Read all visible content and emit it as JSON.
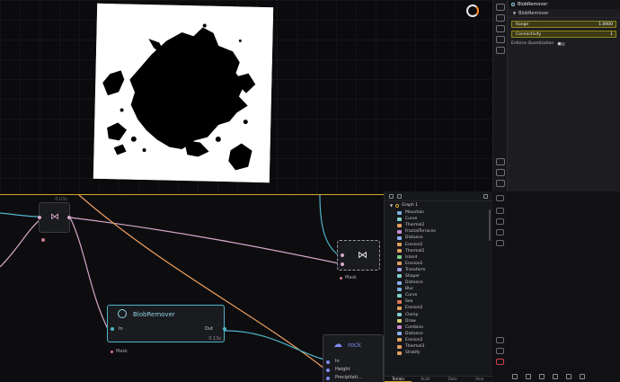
{
  "viewport": {
    "background": "#0b0b0d"
  },
  "properties": {
    "panel_title": "BlobRemover",
    "section_title": "BlobRemover",
    "fields": [
      {
        "label": "Range",
        "value": "1.0000"
      },
      {
        "label": "Connectivity",
        "value": "1"
      }
    ],
    "toggle_label": "Enforce Quantization"
  },
  "graph": {
    "small_node_time": "0.03s",
    "blob_node": {
      "title": "BlobRemover",
      "in_label": "In",
      "out_label": "Out",
      "time": "0.13s",
      "mask_label": "Mask"
    },
    "mid_node": {
      "mask_label": "Mask"
    },
    "rock_node": {
      "title": "rock",
      "pins": [
        "In",
        "Height",
        "Precipitati..."
      ]
    }
  },
  "library": {
    "root": "Graph 1",
    "items": [
      {
        "label": "Mountain",
        "color": "#7fb0e0"
      },
      {
        "label": "Curve",
        "color": "#7fd0c8"
      },
      {
        "label": "Thermal2",
        "color": "#e0a060"
      },
      {
        "label": "FractalTerraces",
        "color": "#c88ad0"
      },
      {
        "label": "Distance",
        "color": "#8ab0f0"
      },
      {
        "label": "Erosion2",
        "color": "#e0a060"
      },
      {
        "label": "Thermal2",
        "color": "#e0a060"
      },
      {
        "label": "Island",
        "color": "#7fd08a"
      },
      {
        "label": "Erosion2",
        "color": "#e0a060"
      },
      {
        "label": "Transform",
        "color": "#a0a0e0"
      },
      {
        "label": "Shaper",
        "color": "#7fd0c8"
      },
      {
        "label": "Distance",
        "color": "#8ab0f0"
      },
      {
        "label": "Blur",
        "color": "#7fb0e0"
      },
      {
        "label": "Curve",
        "color": "#7fd0c8"
      },
      {
        "label": "Sea",
        "color": "#e07a50"
      },
      {
        "label": "Erosion2",
        "color": "#e0a060"
      },
      {
        "label": "Clamp",
        "color": "#7fd0c8"
      },
      {
        "label": "Draw",
        "color": "#d0d070"
      },
      {
        "label": "Combine",
        "color": "#c88ad0"
      },
      {
        "label": "Distance",
        "color": "#8ab0f0"
      },
      {
        "label": "Erosion2",
        "color": "#e0a060"
      },
      {
        "label": "Thermal3",
        "color": "#e0a060"
      },
      {
        "label": "Stratify",
        "color": "#e0a060"
      }
    ],
    "tabs": [
      "Terrain",
      "Build",
      "Data",
      "Item"
    ]
  },
  "colors": {
    "accent_yellow": "#d6a52a",
    "wire_cyan": "#4fb4c9",
    "wire_pink": "#d6a8cc",
    "wire_orange": "#f0a060",
    "rock_purple": "#7f8df0"
  }
}
